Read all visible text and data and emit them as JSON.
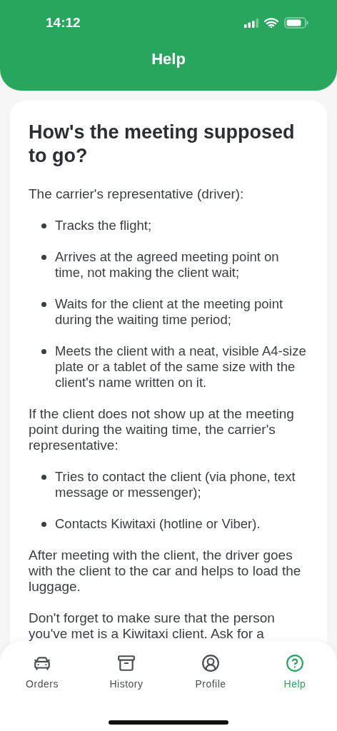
{
  "status_bar": {
    "time": "14:12"
  },
  "header": {
    "title": "Help"
  },
  "article": {
    "heading": "How's the meeting supposed to go?",
    "blocks": [
      {
        "kind": "paragraph",
        "text": "The carrier's representative (driver):"
      },
      {
        "kind": "bullets",
        "items": [
          "Tracks the flight;",
          "Arrives at the agreed meeting point on time, not making the client wait;",
          "Waits for the client at the meeting point during the waiting time period;",
          "Meets the client with a neat, visible A4-size plate or a tablet of the same size with the client's name written on it."
        ]
      },
      {
        "kind": "paragraph",
        "text": "If the client does not show up at the meeting point during the waiting time, the carrier's representative:"
      },
      {
        "kind": "bullets",
        "items": [
          "Tries to contact the client (via phone, text message or messenger);",
          "Contacts Kiwitaxi (hotline or Viber)."
        ]
      },
      {
        "kind": "paragraph",
        "text": "After meeting with the client, the driver goes with the client to the car and helps to load the luggage."
      },
      {
        "kind": "paragraph",
        "text": "Don't forget to make sure that the person you've met is a Kiwitaxi client. Ask for a"
      }
    ]
  },
  "tab_bar": [
    {
      "label": "Orders",
      "selected": false
    },
    {
      "label": "History",
      "selected": false
    },
    {
      "label": "Profile",
      "selected": false
    },
    {
      "label": "Help",
      "selected": true
    }
  ]
}
